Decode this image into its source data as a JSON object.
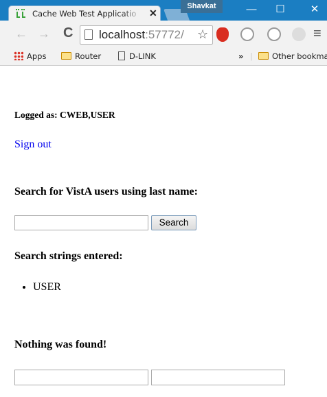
{
  "browser": {
    "profile_name": "Shavkat",
    "tab": {
      "title": "Cache Web Test Applicatio",
      "close_glyph": "✕"
    },
    "window": {
      "minimize": "—",
      "maximize": "☐",
      "close": "✕"
    },
    "nav": {
      "back": "←",
      "forward": "→",
      "reload": "C"
    },
    "address": {
      "host": "localhost",
      "port": ":57772/"
    },
    "bookmarks": {
      "items": [
        {
          "label": "Apps",
          "icon": "apps-grid-icon"
        },
        {
          "label": "Router",
          "icon": "folder-icon"
        },
        {
          "label": "D-LINK",
          "icon": "page-icon"
        }
      ],
      "overflow": "»",
      "other": "Other bookmarks"
    },
    "colors": {
      "titlebar": "#1b7ec2",
      "toolbar": "#f2f2f2"
    }
  },
  "page": {
    "logged_as": "Logged as: CWEB,USER",
    "sign_out": "Sign out",
    "search_heading": "Search for VistA users using last name:",
    "search_input_value": "",
    "search_button": "Search",
    "strings_heading": "Search strings entered:",
    "search_strings": [
      "USER"
    ],
    "result_message": "Nothing was found!",
    "output_field_1": "",
    "output_field_2": "",
    "link_color": "#0000ee"
  }
}
